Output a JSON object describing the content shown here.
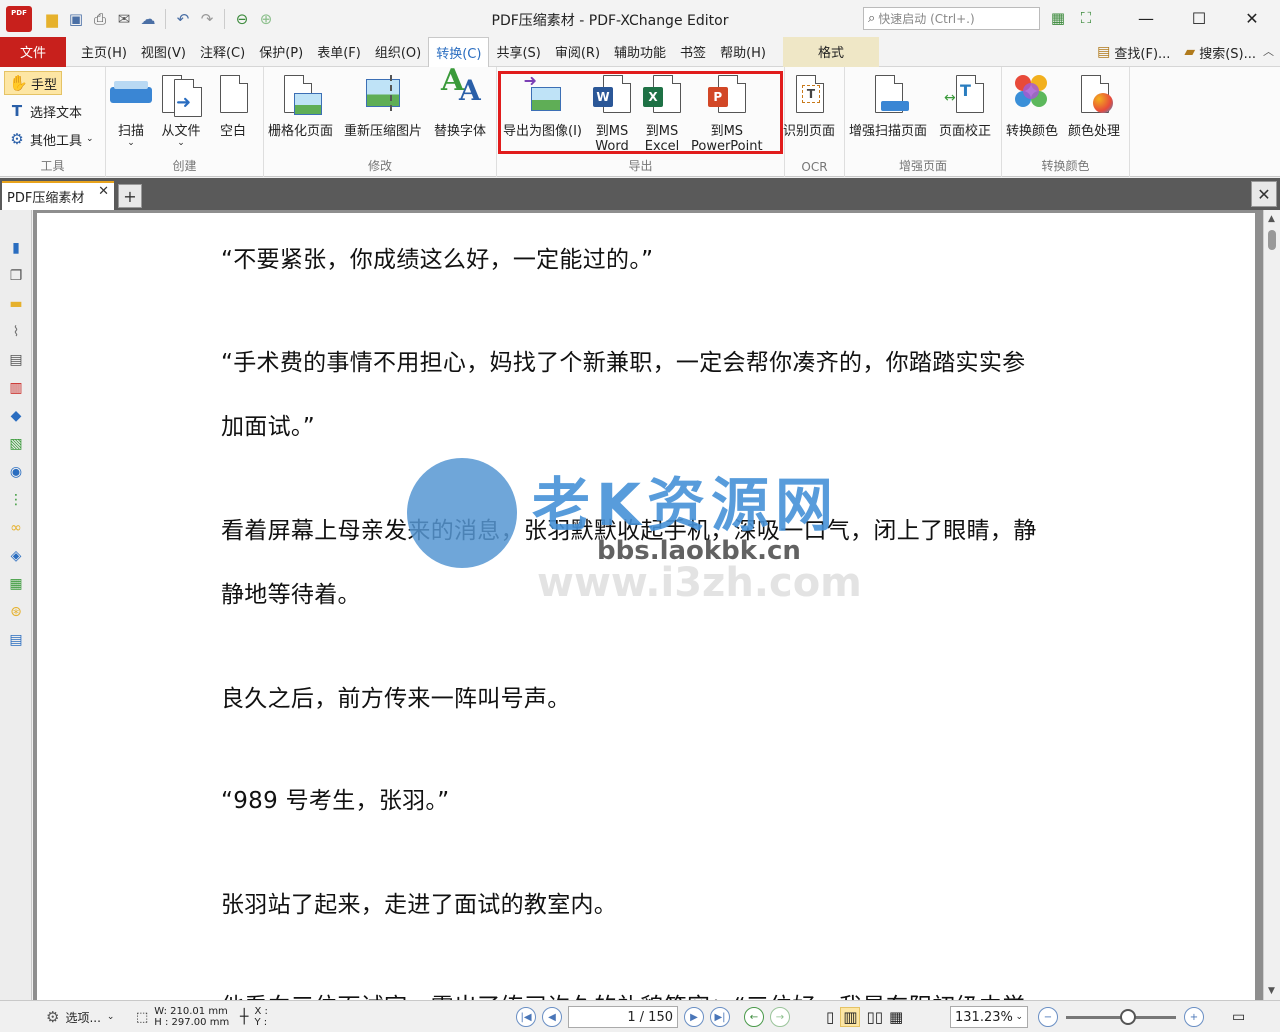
{
  "titlebar": {
    "title": "PDF压缩素材 - PDF-XChange Editor",
    "logo_text": "PDF",
    "quick_launch_placeholder": "快速启动 (Ctrl+.)"
  },
  "menu": {
    "file": "文件",
    "tabs": [
      "主页(H)",
      "视图(V)",
      "注释(C)",
      "保护(P)",
      "表单(F)",
      "组织(O)",
      "转换(C)",
      "共享(S)",
      "审阅(R)",
      "辅助功能",
      "书签",
      "帮助(H)"
    ],
    "active_index": 6,
    "format": "格式",
    "find": "查找(F)...",
    "search": "搜索(S)..."
  },
  "ribbon": {
    "tools": {
      "hand": "手型",
      "select_text": "选择文本",
      "other_tools": "其他工具",
      "label": "工具"
    },
    "create": {
      "scan": "扫描",
      "from_file": "从文件",
      "blank": "空白",
      "label": "创建"
    },
    "modify": {
      "rasterize": "栅格化页面",
      "recompress": "重新压缩图片",
      "replace_fonts": "替换字体",
      "label": "修改"
    },
    "export": {
      "to_image": "导出为图像(I)",
      "to_word_1": "到MS",
      "to_word_2": "Word",
      "to_excel_1": "到MS",
      "to_excel_2": "Excel",
      "to_ppt_1": "到MS",
      "to_ppt_2": "PowerPoint",
      "label": "导出"
    },
    "ocr": {
      "recognize": "识别页面",
      "label": "OCR"
    },
    "enhance": {
      "enhance_scan": "增强扫描页面",
      "deskew": "页面校正",
      "label": "增强页面"
    },
    "colors": {
      "convert": "转换颜色",
      "process": "颜色处理",
      "label": "转换颜色"
    }
  },
  "doc_tab": {
    "name": "PDF压缩素材"
  },
  "document": {
    "paragraphs": [
      "“不要紧张，你成绩这么好，一定能过的。”",
      "“手术费的事情不用担心，妈找了个新兼职，一定会帮你凑齐的，你踏踏实实参",
      "加面试。”",
      "看着屏幕上母亲发来的消息，张羽默默收起手机，深吸一口气，闭上了眼睛，静",
      "静地等待着。",
      "良久之后，前方传来一阵叫号声。",
      "“989 号考生，张羽。”",
      "张羽站了起来，走进了面试的教室内。",
      "他看向三位面试官，露出了练习许久的礼貌笑容：“三位好，我是东阳初级中学"
    ]
  },
  "watermark": {
    "main": "老K资源网",
    "url1": "bbs.laokbk.cn",
    "url2": "www.i3zh.com"
  },
  "status": {
    "options": "选项...",
    "width": "W: 210.01 mm",
    "height": "H : 297.00 mm",
    "x": "X :",
    "y": "Y :",
    "page_current": "1",
    "page_total": "/ 150",
    "zoom": "131.23%"
  },
  "colors": {
    "accent_red": "#c8201c",
    "highlight": "#e11c1c",
    "active_tab_text": "#2a6dc0",
    "watermark_blue": "#4691d7"
  }
}
